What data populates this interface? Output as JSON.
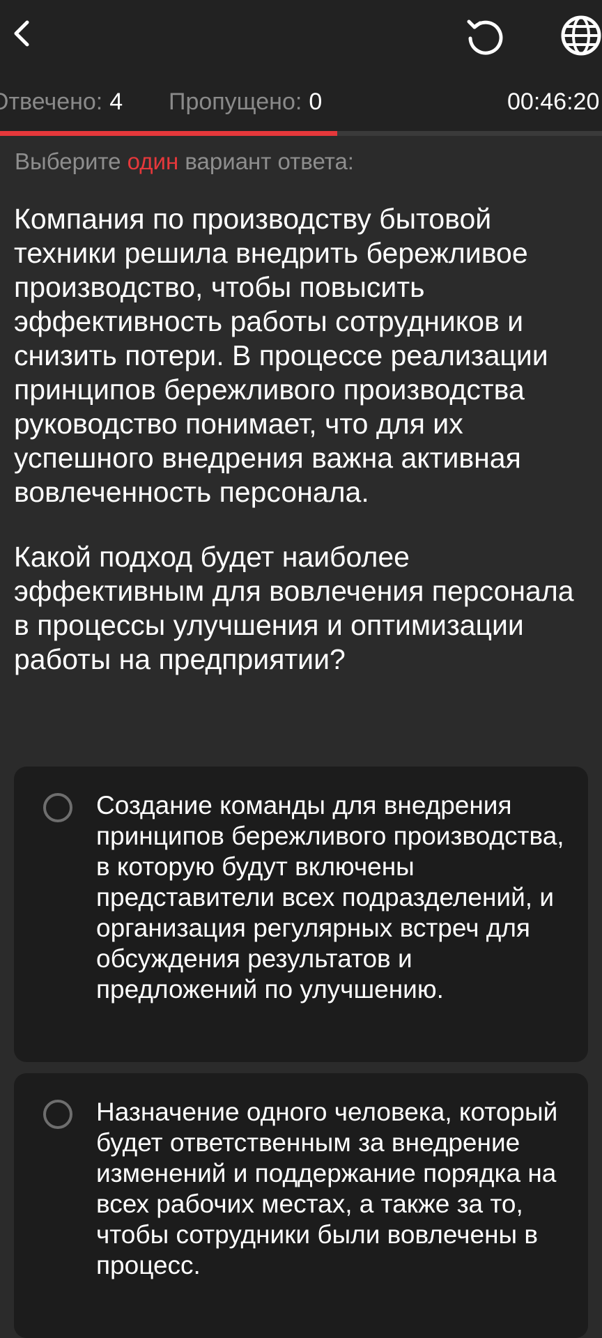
{
  "header": {
    "back_icon": "chevron-left-icon",
    "refresh_icon": "refresh-icon",
    "language_icon": "globe-icon"
  },
  "stats": {
    "answered_label": "Отвечено:",
    "answered_value": "4",
    "skipped_label": "Пропущено:",
    "skipped_value": "0",
    "timer": "00:46:20"
  },
  "progress": {
    "fraction": 0.56,
    "color": "#e5383b"
  },
  "instruction": {
    "prefix": "Выберите",
    "highlight": "один",
    "suffix": "вариант ответа:"
  },
  "question": {
    "context": "Компания по производству бытовой техники решила внедрить бережливое производство, чтобы повысить эффективность работы сотрудников и снизить потери. В процессе реализации принципов бережливого производства руководство понимает, что для их успешного внедрения важна активная вовлеченность персонала.",
    "prompt": "Какой подход будет наиболее эффективным для вовлечения персонала в процессы улучшения и оптимизации работы на предприятии?"
  },
  "options": [
    {
      "text": "Создание команды для внедрения принципов бережливого производства, в которую будут включены представители всех подразделений, и организация регулярных встреч для обсуждения результатов и предложений по улучшению.",
      "selected": false
    },
    {
      "text": "Назначение одного человека, который будет ответственным за внедрение изменений и поддержание порядка на всех рабочих местах, а также за то, чтобы сотрудники были вовлечены в процесс.",
      "selected": false
    }
  ]
}
